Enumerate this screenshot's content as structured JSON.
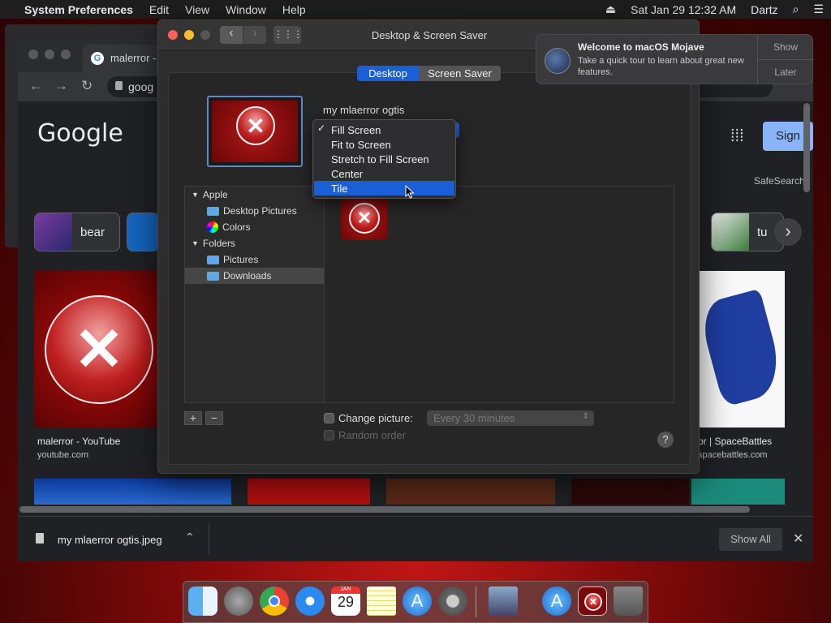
{
  "menubar": {
    "apple": "",
    "app": "System Preferences",
    "items": [
      "Edit",
      "View",
      "Window",
      "Help"
    ],
    "datetime": "Sat Jan 29  12:32 AM",
    "user": "Dartz"
  },
  "chrome": {
    "tab_title": "malerror -",
    "url": "goog",
    "logo": "Google",
    "signin": "Sign",
    "safesearch": "SafeSearch",
    "chips": [
      "bear",
      "tu"
    ],
    "results": [
      {
        "title": "malerror - YouTube",
        "site": "youtube.com"
      },
      {
        "title": "or | SpaceBattles",
        "site": "spacebattles.com"
      }
    ],
    "download_file": "my mlaerror ogtis.jpeg",
    "show_all": "Show All"
  },
  "prefs": {
    "title": "Desktop & Screen Saver",
    "tabs": [
      "Desktop",
      "Screen Saver"
    ],
    "active_tab": "Desktop",
    "picture_name": "my mlaerror ogtis",
    "sources": {
      "apple_header": "Apple",
      "apple_items": [
        "Desktop Pictures",
        "Colors"
      ],
      "folders_header": "Folders",
      "folder_items": [
        "Pictures",
        "Downloads"
      ],
      "selected": "Downloads"
    },
    "change_picture_label": "Change picture:",
    "interval": "Every 30 minutes",
    "random_label": "Random order",
    "help": "?",
    "add": "+",
    "remove": "−"
  },
  "popup": {
    "items": [
      "Fill Screen",
      "Fit to Screen",
      "Stretch to Fill Screen",
      "Center",
      "Tile"
    ],
    "checked": "Fill Screen",
    "highlighted": "Tile"
  },
  "notification": {
    "title": "Welcome to macOS Mojave",
    "body": "Take a quick tour to learn about great new features.",
    "show": "Show",
    "later": "Later"
  },
  "dock": {
    "calendar_month": "JAN",
    "calendar_day": "29"
  },
  "colors": {
    "accent": "#1a5fd6",
    "chip_blue": "#8ab4f8"
  }
}
